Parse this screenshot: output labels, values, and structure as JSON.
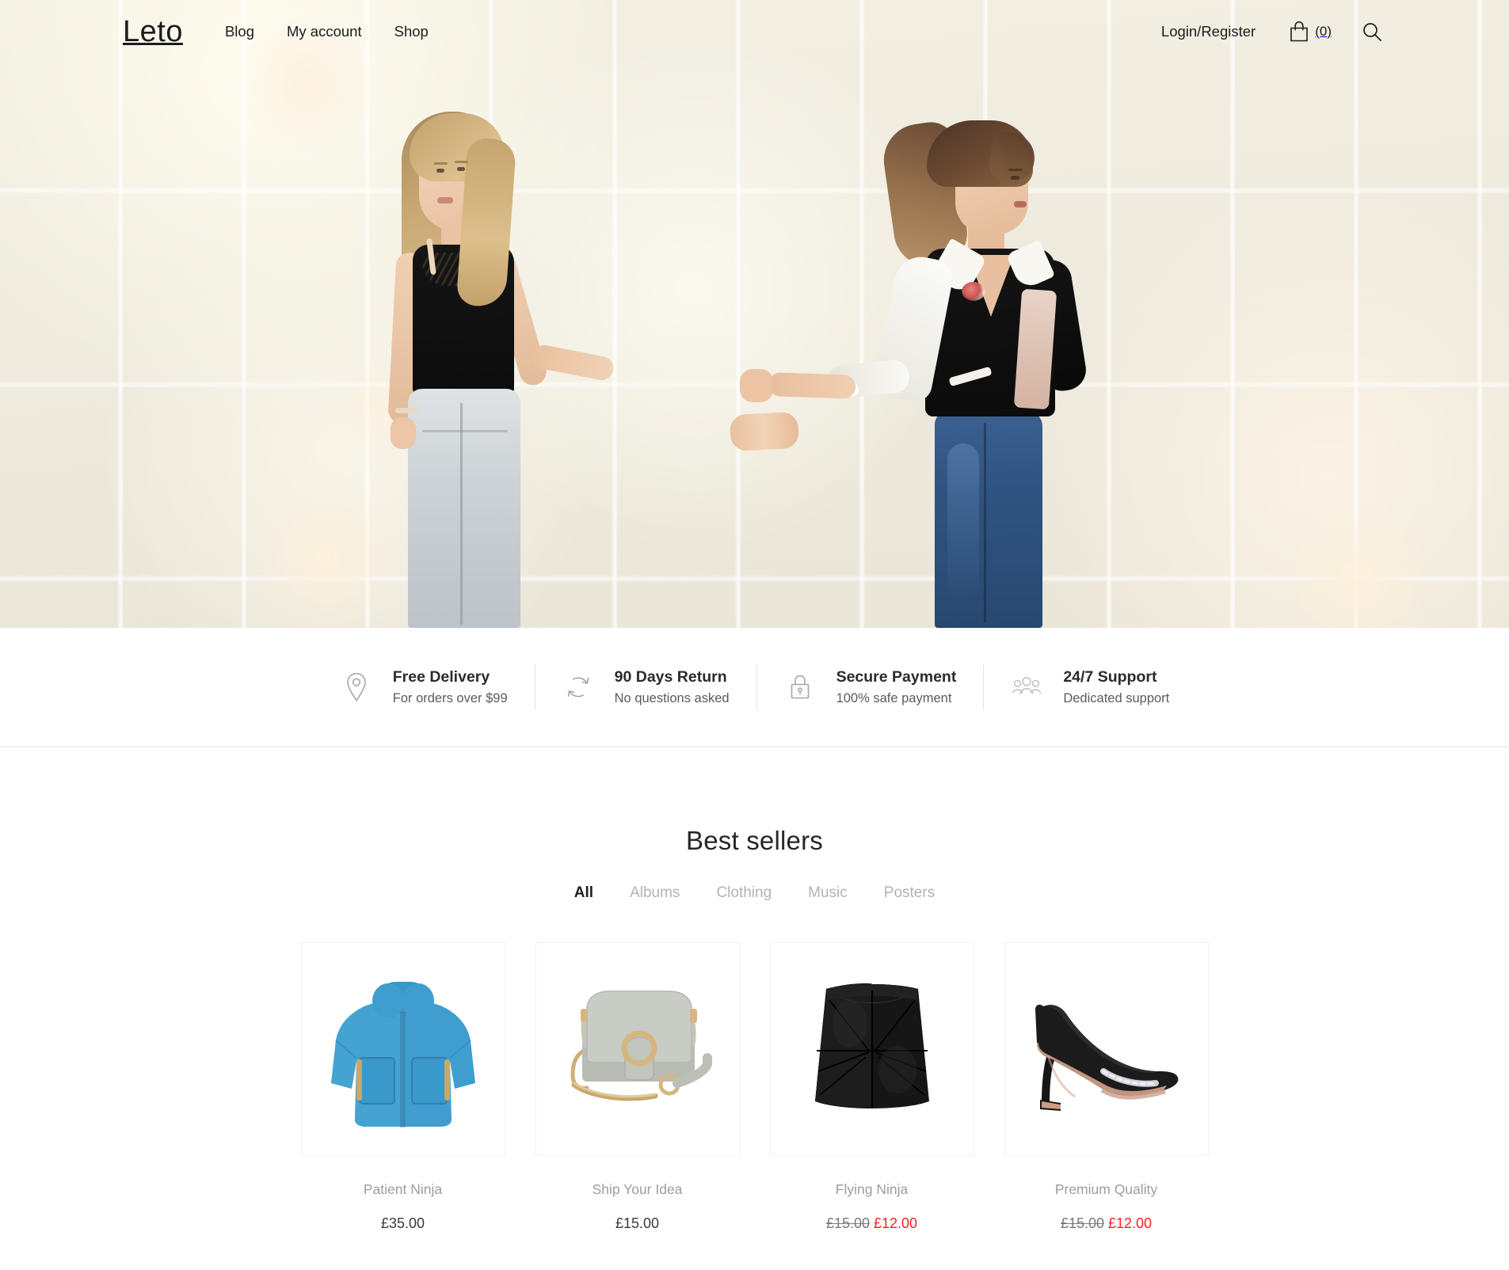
{
  "header": {
    "brand": "Leto",
    "nav": [
      {
        "label": "Blog",
        "name": "nav-blog"
      },
      {
        "label": "My account",
        "name": "nav-my-account"
      },
      {
        "label": "Shop",
        "name": "nav-shop"
      }
    ],
    "login_label": "Login/Register",
    "cart_count": "(0)",
    "cart_icon": "shopping-bag-icon",
    "search_icon": "search-icon"
  },
  "hero": {
    "alt": "Two women holding hands in front of a cream tiled wall",
    "background_color": "#eeeade"
  },
  "features": [
    {
      "icon": "location-pin-icon",
      "title": "Free Delivery",
      "subtitle": "For orders over $99"
    },
    {
      "icon": "refresh-arrows-icon",
      "title": "90 Days Return",
      "subtitle": "No questions asked"
    },
    {
      "icon": "lock-icon",
      "title": "Secure Payment",
      "subtitle": "100% safe payment"
    },
    {
      "icon": "support-people-icon",
      "title": "24/7 Support",
      "subtitle": "Dedicated support"
    }
  ],
  "bestsellers": {
    "title": "Best sellers",
    "tabs": [
      {
        "label": "All",
        "active": true
      },
      {
        "label": "Albums",
        "active": false
      },
      {
        "label": "Clothing",
        "active": false
      },
      {
        "label": "Music",
        "active": false
      },
      {
        "label": "Posters",
        "active": false
      }
    ],
    "products": [
      {
        "name": "Patient Ninja",
        "image": "blue-fur-jacket",
        "price": "£35.00",
        "on_sale": false,
        "old_price": "",
        "new_price": ""
      },
      {
        "name": "Ship Your Idea",
        "image": "grey-crossbody-bag",
        "price": "£15.00",
        "on_sale": false,
        "old_price": "",
        "new_price": ""
      },
      {
        "name": "Flying Ninja",
        "image": "black-leather-skirt",
        "price": "",
        "on_sale": true,
        "old_price": "£15.00",
        "new_price": "£12.00"
      },
      {
        "name": "Premium Quality",
        "image": "black-heel-shoe",
        "price": "",
        "on_sale": true,
        "old_price": "£15.00",
        "new_price": "£12.00"
      }
    ]
  },
  "colors": {
    "sale_red": "#ff1f1f",
    "text_dark": "#1c1c1c",
    "text_muted": "#9d9d9d",
    "hero_bg": "#eeeade"
  }
}
